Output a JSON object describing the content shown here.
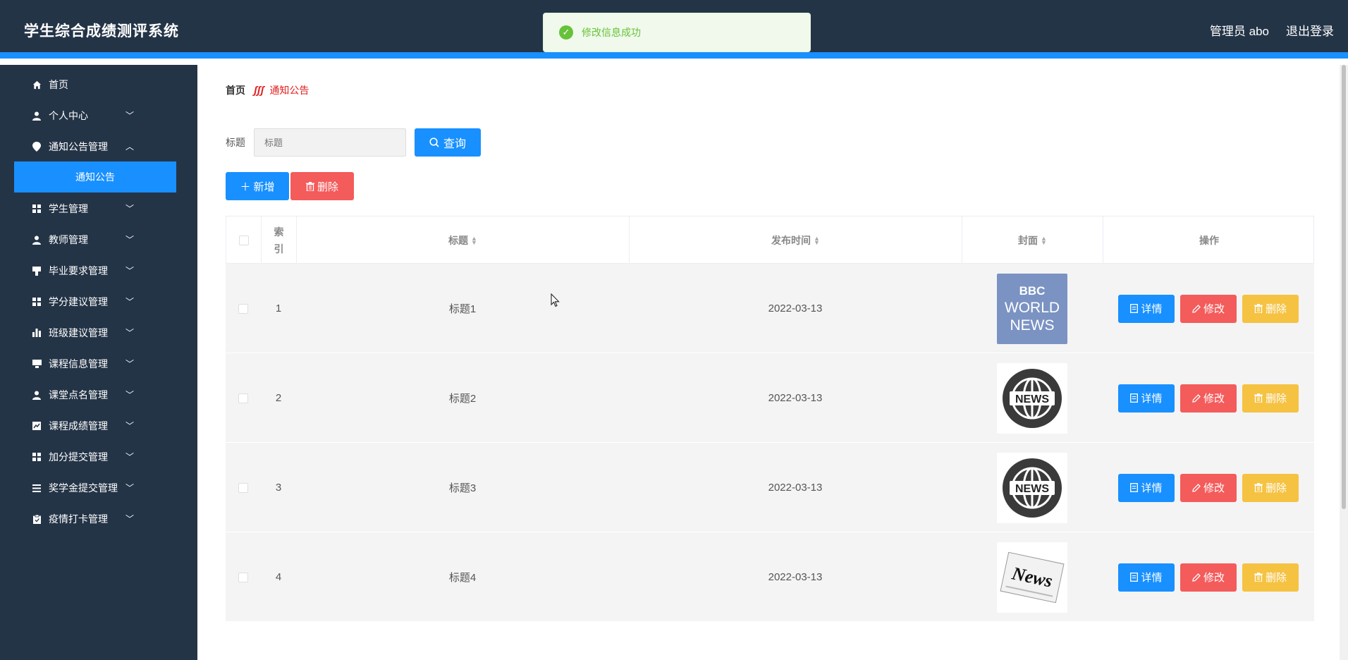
{
  "header": {
    "title": "学生综合成绩测评系统",
    "user": "管理员 abo",
    "logout": "退出登录"
  },
  "toast": {
    "message": "修改信息成功"
  },
  "sidebar": {
    "items": [
      {
        "label": "首页",
        "icon": "home-icon"
      },
      {
        "label": "个人中心",
        "icon": "user-icon"
      },
      {
        "label": "通知公告管理",
        "icon": "location-icon"
      },
      {
        "label": "学生管理",
        "icon": "grid-icon"
      },
      {
        "label": "教师管理",
        "icon": "user-icon"
      },
      {
        "label": "毕业要求管理",
        "icon": "flag-icon"
      },
      {
        "label": "学分建议管理",
        "icon": "grid-icon"
      },
      {
        "label": "班级建议管理",
        "icon": "bar-chart-icon"
      },
      {
        "label": "课程信息管理",
        "icon": "monitor-icon"
      },
      {
        "label": "课堂点名管理",
        "icon": "user-icon"
      },
      {
        "label": "课程成绩管理",
        "icon": "chart-icon"
      },
      {
        "label": "加分提交管理",
        "icon": "grid-icon"
      },
      {
        "label": "奖学金提交管理",
        "icon": "list-icon"
      },
      {
        "label": "疫情打卡管理",
        "icon": "clipboard-icon"
      }
    ],
    "active_sub": "通知公告"
  },
  "breadcrumb": {
    "home": "首页",
    "current": "通知公告"
  },
  "search": {
    "label": "标题",
    "placeholder": "标题",
    "query_label": "查询"
  },
  "actions": {
    "add_label": "新增",
    "delete_label": "删除"
  },
  "table": {
    "headers": {
      "index": "索引",
      "title": "标题",
      "publish_time": "发布时间",
      "cover": "封面",
      "operation": "操作"
    },
    "rows": [
      {
        "index": "1",
        "title": "标题1",
        "time": "2022-03-13",
        "cover": "bbc"
      },
      {
        "index": "2",
        "title": "标题2",
        "time": "2022-03-13",
        "cover": "globe"
      },
      {
        "index": "3",
        "title": "标题3",
        "time": "2022-03-13",
        "cover": "globe"
      },
      {
        "index": "4",
        "title": "标题4",
        "time": "2022-03-13",
        "cover": "paper"
      }
    ],
    "op_labels": {
      "detail": "详情",
      "edit": "修改",
      "delete": "删除"
    }
  },
  "covers": {
    "bbc": {
      "line1": "BBC",
      "line2": "WORLD",
      "line3": "NEWS"
    },
    "globe": {
      "text": "NEWS"
    },
    "paper": {
      "text": "News"
    }
  }
}
